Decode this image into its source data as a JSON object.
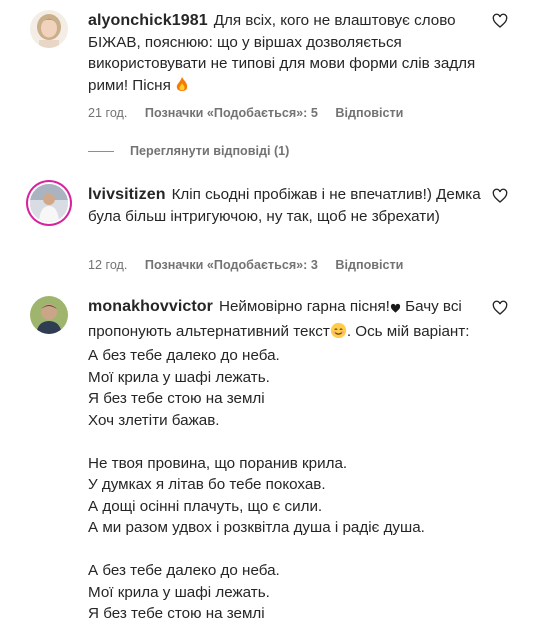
{
  "comments": [
    {
      "username": "alyonchick1981",
      "text": "Для всіх, кого не влаштовує слово БІЖАВ, пояснюю: що у віршах дозволяється використовувати не типові для мови форми слів задля рими! Пісня",
      "time": "21 год.",
      "likes": "Позначки «Подобається»: 5",
      "reply": "Відповісти",
      "view_replies": "Переглянути відповіді (1)"
    },
    {
      "username": "lvivsitizen",
      "text": "Кліп сьодні пробіжав і не впечатлив!) Демка була більш інтригуючою, ну так, щоб не збрехати)",
      "time": "12 год.",
      "likes": "Позначки «Подобається»: 3",
      "reply": "Відповісти"
    },
    {
      "username": "monakhovvictor",
      "text_intro_1": "Неймовірно гарна пісня!",
      "text_intro_2": " Бачу всі пропонують альтернативний текст",
      "text_intro_3": ". Ось мій варіант:",
      "lines": [
        "А без тебе далеко до неба.",
        "Мої крила у шафі лежать.",
        "Я без тебе стою на землі",
        "Хоч злетіти бажав.",
        "",
        "Не твоя провина, що поранив крила.",
        "У думках я літав бо тебе покохав.",
        "А дощі осінні плачуть, що є сили.",
        "А ми разом удвох і розквітла душа і радіє душа.",
        "",
        "А без тебе далеко до неба.",
        "Мої крила у шафі лежать.",
        "Я без тебе стою на землі"
      ]
    }
  ],
  "icons": {
    "heart": "heart-outline-icon",
    "fire": "fire-emoji",
    "black_heart": "black-heart-emoji",
    "smile": "smiling-face-emoji"
  },
  "colors": {
    "text": "#262626",
    "meta": "#737373",
    "ring": "#d6249f"
  }
}
